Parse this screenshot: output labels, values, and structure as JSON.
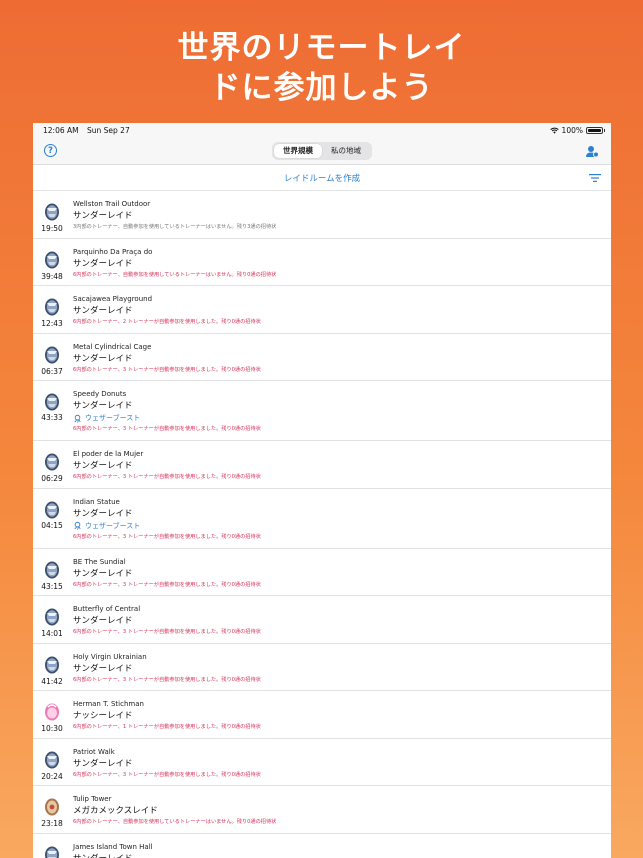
{
  "headline": [
    "世界のリモートレイ",
    "ドに参加しよう"
  ],
  "status_bar": {
    "time": "12:06 AM",
    "date": "Sun Sep 27",
    "battery": "100%"
  },
  "nav": {
    "segments": [
      "世界規模",
      "私の地域"
    ],
    "active_segment": 0
  },
  "toolbar": {
    "create_label": "レイドルームを作成"
  },
  "colors": {
    "accent": "#2b7fd4",
    "warning": "#d6335a",
    "muted": "#777777",
    "bg_top": "#ee6c34",
    "bg_bottom": "#f9a860"
  },
  "raids": [
    {
      "gym": "Wellston Trail Outdoor",
      "raid": "サンダーレイド",
      "time": "19:50",
      "info": "3内部のトレーナー、自動参加を使用しているトレーナーはいません。残り3通の招待状",
      "status": "gray",
      "egg": "thunder",
      "boost": ""
    },
    {
      "gym": "Parquinho Da Praça do",
      "raid": "サンダーレイド",
      "time": "39:48",
      "info": "6内部のトレーナー、自動参加を使用しているトレーナーはいません。残り0通の招待状",
      "status": "red",
      "egg": "thunder",
      "boost": ""
    },
    {
      "gym": "Sacajawea Playground",
      "raid": "サンダーレイド",
      "time": "12:43",
      "info": "6内部のトレーナー、2 トレーナーが自動参加を使用しました。残り0通の招待状",
      "status": "red",
      "egg": "thunder",
      "boost": ""
    },
    {
      "gym": "Metal Cylindrical Cage",
      "raid": "サンダーレイド",
      "time": "06:37",
      "info": "6内部のトレーナー、3 トレーナーが自動参加を使用しました。残り0通の招待状",
      "status": "red",
      "egg": "thunder",
      "boost": ""
    },
    {
      "gym": "Speedy Donuts",
      "raid": "サンダーレイド",
      "time": "43:33",
      "info": "6内部のトレーナー、3 トレーナーが自動参加を使用しました。残り0通の招待状",
      "status": "red",
      "egg": "thunder",
      "boost": "ウェザーブースト"
    },
    {
      "gym": "El poder de la Mujer",
      "raid": "サンダーレイド",
      "time": "06:29",
      "info": "6内部のトレーナー、3 トレーナーが自動参加を使用しました。残り0通の招待状",
      "status": "red",
      "egg": "thunder",
      "boost": ""
    },
    {
      "gym": "Indian Statue",
      "raid": "サンダーレイド",
      "time": "04:15",
      "info": "6内部のトレーナー、3 トレーナーが自動参加を使用しました。残り0通の招待状",
      "status": "red",
      "egg": "thunder",
      "boost": "ウェザーブースト"
    },
    {
      "gym": "BE The Sundial",
      "raid": "サンダーレイド",
      "time": "43:15",
      "info": "6内部のトレーナー、3 トレーナーが自動参加を使用しました。残り0通の招待状",
      "status": "red",
      "egg": "thunder",
      "boost": ""
    },
    {
      "gym": "Butterfly of Central",
      "raid": "サンダーレイド",
      "time": "14:01",
      "info": "6内部のトレーナー、3 トレーナーが自動参加を使用しました。残り0通の招待状",
      "status": "red",
      "egg": "thunder",
      "boost": ""
    },
    {
      "gym": "Holy Virgin Ukrainian",
      "raid": "サンダーレイド",
      "time": "41:42",
      "info": "6内部のトレーナー、3 トレーナーが自動参加を使用しました。残り0通の招待状",
      "status": "red",
      "egg": "thunder",
      "boost": ""
    },
    {
      "gym": "Herman T. Stichman",
      "raid": "ナッシーレイド",
      "time": "10:30",
      "info": "6内部のトレーナー、1 トレーナーが自動参加を使用しました。残り0通の招待状",
      "status": "red",
      "egg": "pink",
      "boost": ""
    },
    {
      "gym": "Patriot Walk",
      "raid": "サンダーレイド",
      "time": "20:24",
      "info": "6内部のトレーナー、3 トレーナーが自動参加を使用しました。残り0通の招待状",
      "status": "red",
      "egg": "thunder",
      "boost": ""
    },
    {
      "gym": "Tulip Tower",
      "raid": "メガカメックスレイド",
      "time": "23:18",
      "info": "6内部のトレーナー、自動参加を使用しているトレーナーはいません。残り0通の招待状",
      "status": "red",
      "egg": "mega",
      "boost": ""
    },
    {
      "gym": "James Island Town Hall",
      "raid": "サンダーレイド",
      "time": "",
      "info": "",
      "status": "red",
      "egg": "thunder",
      "boost": ""
    }
  ]
}
